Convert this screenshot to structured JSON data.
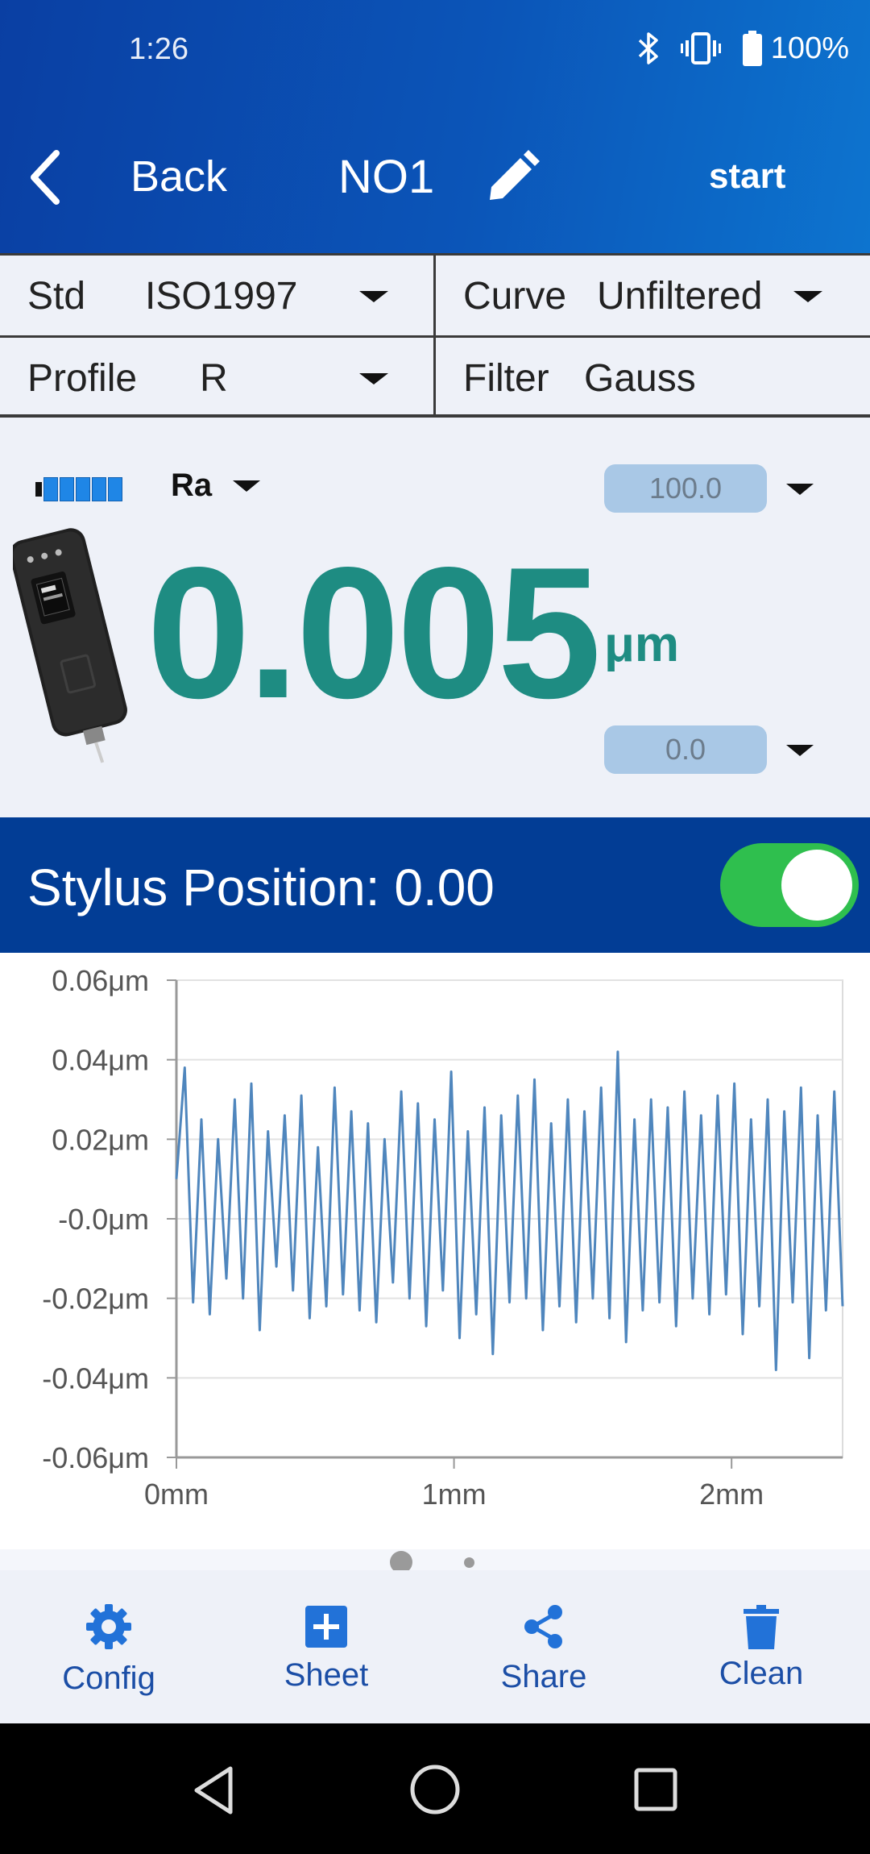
{
  "status_bar": {
    "time": "1:26",
    "battery": "100%"
  },
  "header": {
    "back_label": "Back",
    "title": "NO1",
    "start_label": "start"
  },
  "settings": {
    "std": {
      "label": "Std",
      "value": "ISO1997"
    },
    "curve": {
      "label": "Curve",
      "value": "Unfiltered"
    },
    "profile": {
      "label": "Profile",
      "value": "R"
    },
    "filter": {
      "label": "Filter",
      "value": "Gauss"
    }
  },
  "reading": {
    "parameter": "Ra",
    "upper_limit": "100.0",
    "lower_limit": "0.0",
    "value": "0.005",
    "unit": "μm",
    "probe_battery_level": 1.0
  },
  "stylus": {
    "label": "Stylus Position: 0.00",
    "toggle_on": true
  },
  "chart_data": {
    "type": "line",
    "title": "",
    "xlabel": "",
    "ylabel": "",
    "x_unit": "mm",
    "y_unit": "μm",
    "xlim": [
      0,
      2.4
    ],
    "ylim": [
      -0.06,
      0.06
    ],
    "x_ticks": [
      "0mm",
      "1mm",
      "2mm"
    ],
    "y_ticks": [
      "0.06μm",
      "0.04μm",
      "0.02μm",
      "-0.0μm",
      "-0.02μm",
      "-0.04μm",
      "-0.06μm"
    ],
    "grid": true,
    "series": [
      {
        "color": "#4f86bd",
        "x": [
          0,
          0.03,
          0.06,
          0.09,
          0.12,
          0.15,
          0.18,
          0.21,
          0.24,
          0.27,
          0.3,
          0.33,
          0.36,
          0.39,
          0.42,
          0.45,
          0.48,
          0.51,
          0.54,
          0.57,
          0.6,
          0.63,
          0.66,
          0.69,
          0.72,
          0.75,
          0.78,
          0.81,
          0.84,
          0.87,
          0.9,
          0.93,
          0.96,
          0.99,
          1.02,
          1.05,
          1.08,
          1.11,
          1.14,
          1.17,
          1.2,
          1.23,
          1.26,
          1.29,
          1.32,
          1.35,
          1.38,
          1.41,
          1.44,
          1.47,
          1.5,
          1.53,
          1.56,
          1.59,
          1.62,
          1.65,
          1.68,
          1.71,
          1.74,
          1.77,
          1.8,
          1.83,
          1.86,
          1.89,
          1.92,
          1.95,
          1.98,
          2.01,
          2.04,
          2.07,
          2.1,
          2.13,
          2.16,
          2.19,
          2.22,
          2.25,
          2.28,
          2.31,
          2.34,
          2.37,
          2.4
        ],
        "y": [
          0.01,
          0.038,
          -0.021,
          0.025,
          -0.024,
          0.02,
          -0.015,
          0.03,
          -0.02,
          0.034,
          -0.028,
          0.022,
          -0.012,
          0.026,
          -0.018,
          0.031,
          -0.025,
          0.018,
          -0.022,
          0.033,
          -0.019,
          0.027,
          -0.023,
          0.024,
          -0.026,
          0.02,
          -0.016,
          0.032,
          -0.02,
          0.029,
          -0.027,
          0.025,
          -0.018,
          0.037,
          -0.03,
          0.022,
          -0.024,
          0.028,
          -0.034,
          0.026,
          -0.021,
          0.031,
          -0.02,
          0.035,
          -0.028,
          0.024,
          -0.022,
          0.03,
          -0.026,
          0.027,
          -0.02,
          0.033,
          -0.025,
          0.042,
          -0.031,
          0.025,
          -0.023,
          0.03,
          -0.021,
          0.028,
          -0.027,
          0.032,
          -0.02,
          0.026,
          -0.024,
          0.031,
          -0.019,
          0.034,
          -0.029,
          0.025,
          -0.022,
          0.03,
          -0.038,
          0.027,
          -0.021,
          0.033,
          -0.035,
          0.026,
          -0.023,
          0.032,
          -0.022
        ]
      }
    ]
  },
  "pager": {
    "pages": 2,
    "active": 0
  },
  "bottom_nav": [
    {
      "label": "Config",
      "icon": "gear-icon"
    },
    {
      "label": "Sheet",
      "icon": "plus-square-icon"
    },
    {
      "label": "Share",
      "icon": "share-icon"
    },
    {
      "label": "Clean",
      "icon": "trash-icon"
    }
  ],
  "system_nav": [
    "back",
    "home",
    "recents"
  ]
}
